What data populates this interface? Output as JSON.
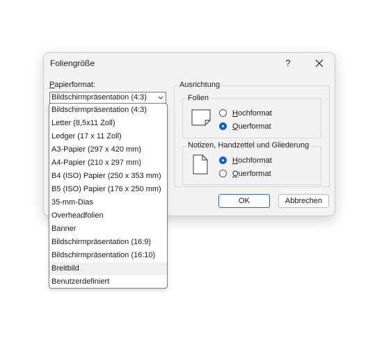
{
  "dialog": {
    "title": "Foliengröße",
    "help": "?",
    "paper": {
      "label_u": "P",
      "label_rest": "apierformat:",
      "selected": "Bildschirmpräsentation (4:3)"
    },
    "orientation": {
      "title": "Ausrichtung",
      "slides": {
        "title": "Folien",
        "portrait_u": "H",
        "portrait_rest": "ochformat",
        "landscape_u": "Q",
        "landscape_rest": "uerformat"
      },
      "notes": {
        "title": "Notizen, Handzettel und Gliederung",
        "portrait_u": "H",
        "portrait_rest": "ochformat",
        "landscape_u": "Q",
        "landscape_rest": "uerformat"
      }
    },
    "ok_label": "OK",
    "cancel_label": "Abbrechen"
  },
  "dropdown": {
    "items": [
      "Bildschirmpräsentation (4:3)",
      "Letter (8,5x11 Zoll)",
      "Ledger (17 x 11 Zoll)",
      "A3-Papier (297 x 420 mm)",
      "A4-Papier (210 x 297 mm)",
      "B4 (ISO) Papier (250 x 353 mm)",
      "B5 (ISO) Papier (176 x 250 mm)",
      "35-mm-Dias",
      "Overheadfolien",
      "Banner",
      "Bildschirmpräsentation (16:9)",
      "Bildschirmpräsentation (16:10)",
      "Breitbild",
      "Benutzerdefiniert"
    ],
    "hovered_index": 12
  },
  "colors": {
    "accent": "#0f5fcd"
  }
}
